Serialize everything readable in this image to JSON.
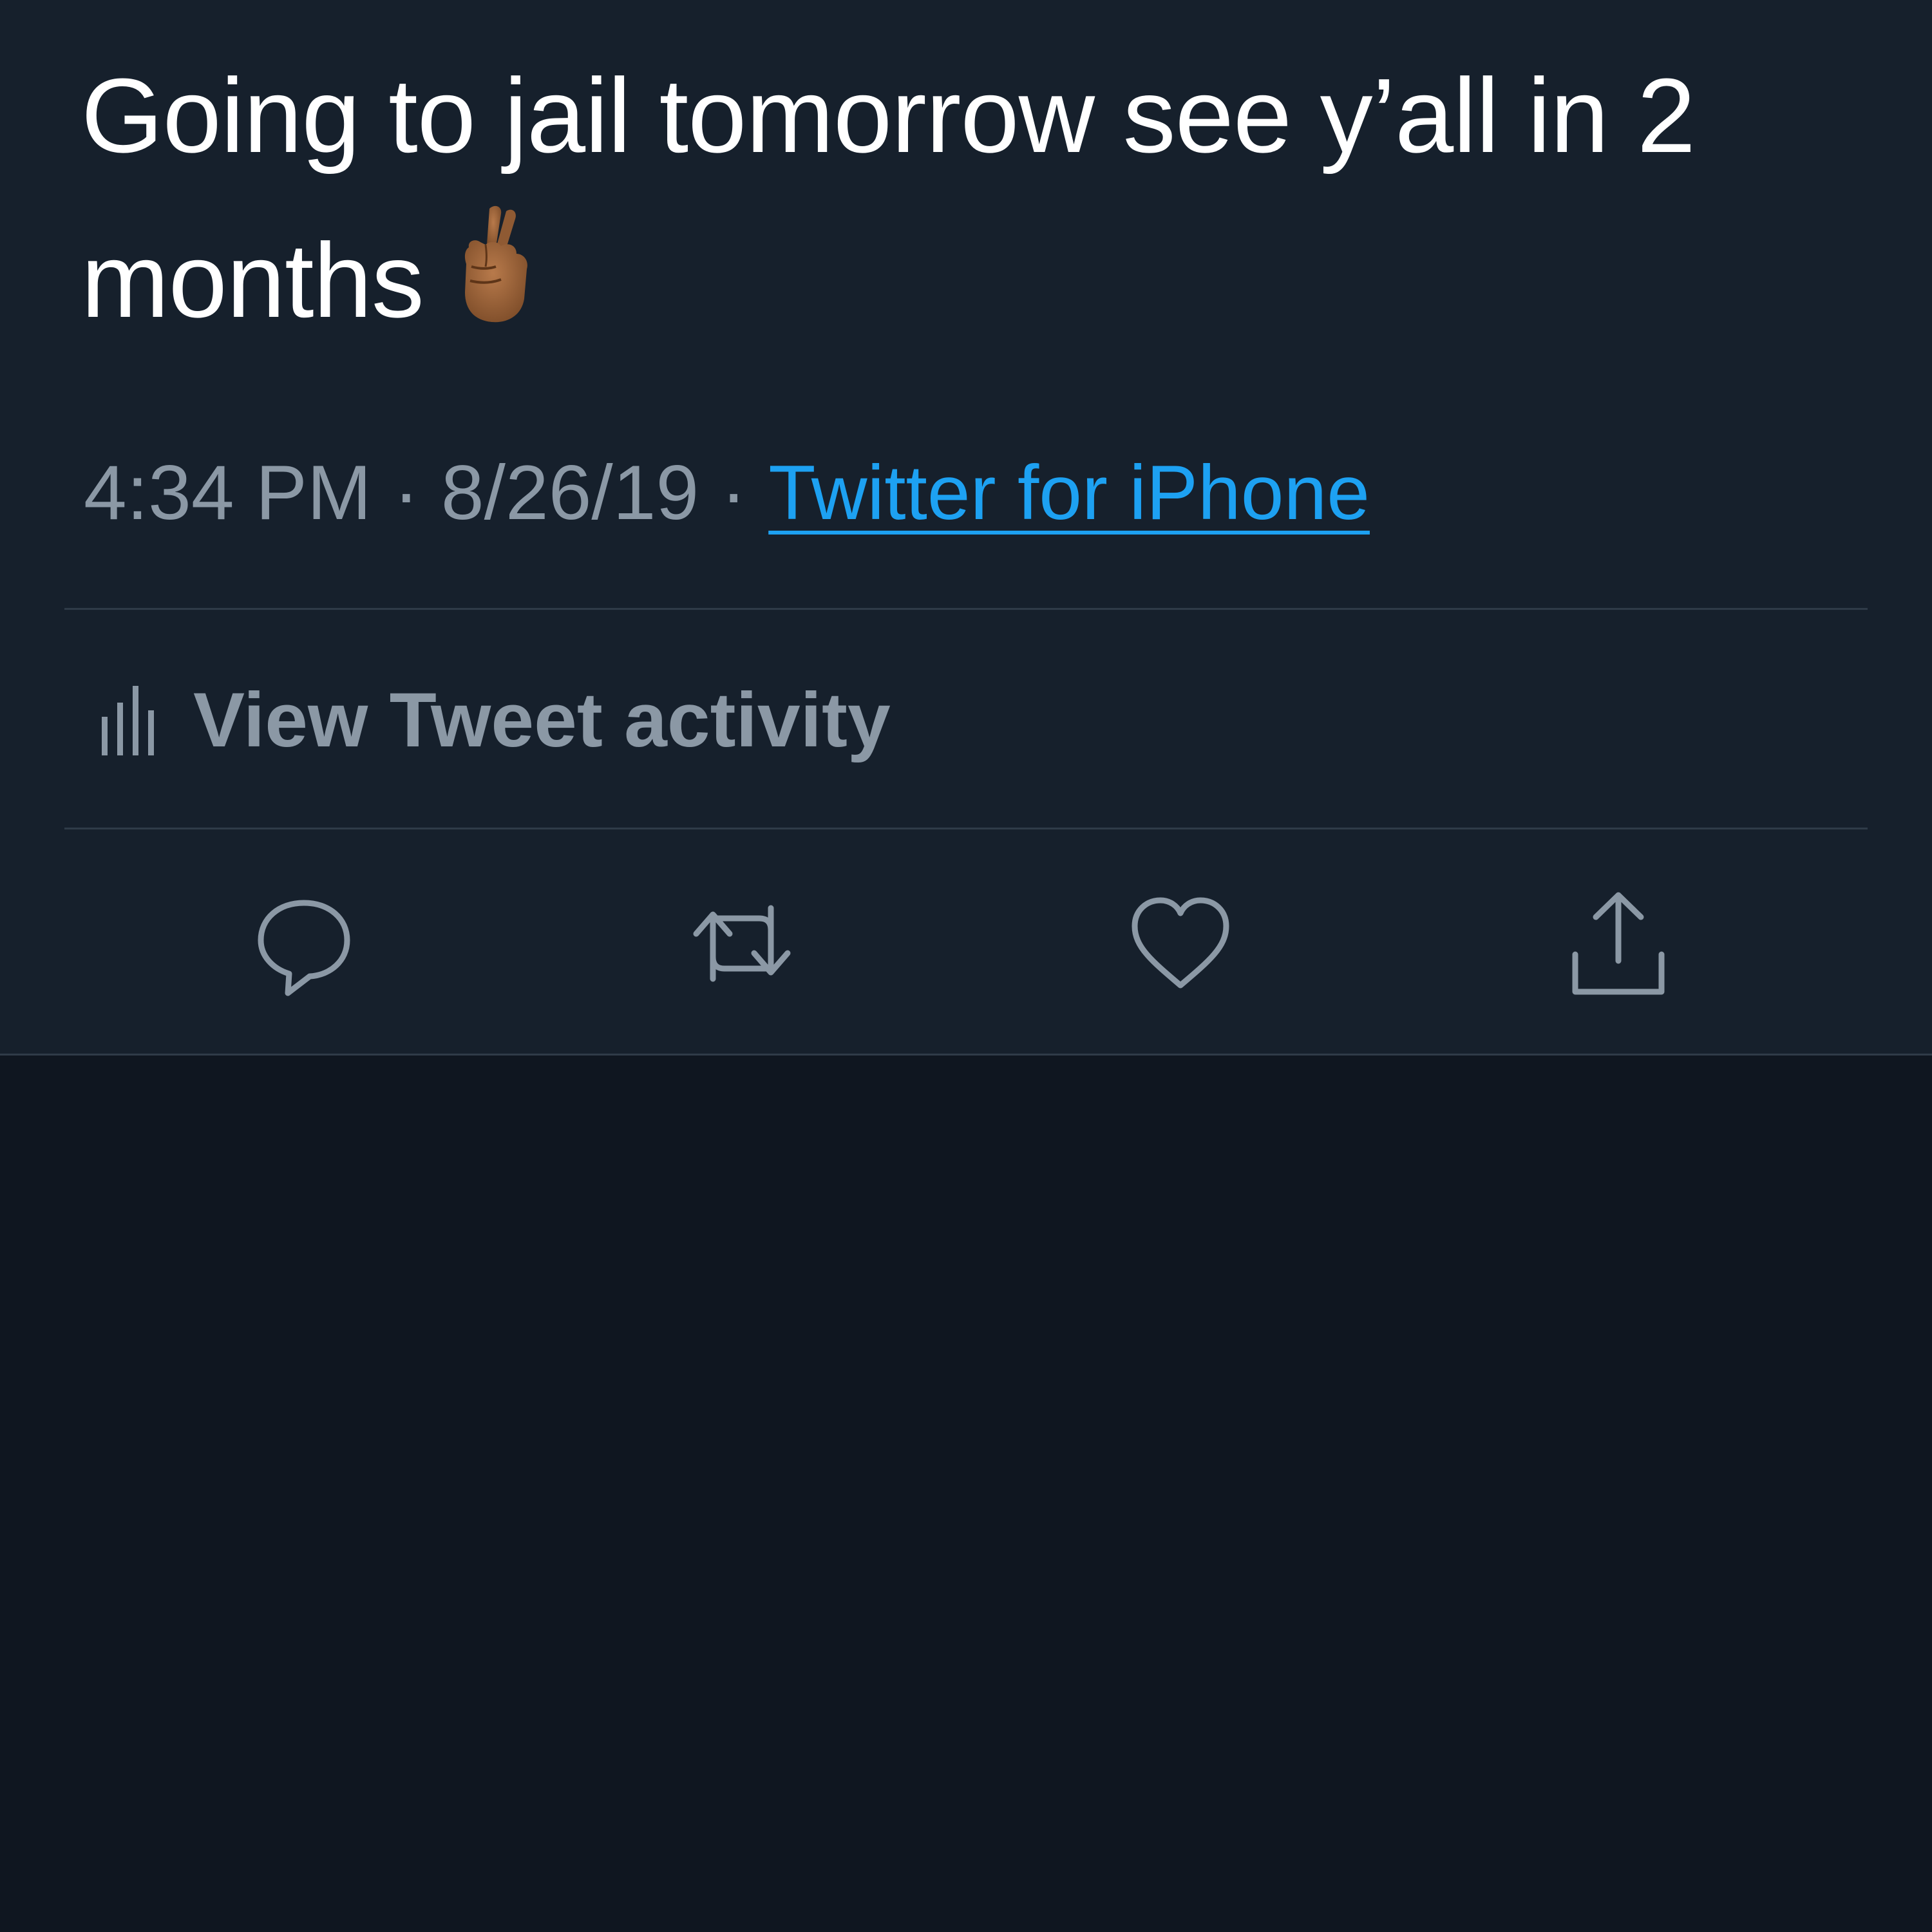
{
  "tweet": {
    "text": "Going to jail tomorrow see y’all in 2 months",
    "emoji": "crossed-fingers",
    "time": "4:34 PM",
    "separator": "·",
    "date": "8/26/19",
    "source": "Twitter for iPhone"
  },
  "activity": {
    "icon": "bar-chart-icon",
    "label": "View Tweet activity"
  },
  "actions": [
    {
      "name": "reply",
      "icon": "speech-bubble-icon"
    },
    {
      "name": "retweet",
      "icon": "retweet-arrows-icon"
    },
    {
      "name": "like",
      "icon": "heart-icon"
    },
    {
      "name": "share",
      "icon": "share-upload-icon"
    }
  ],
  "colors": {
    "background": "#0f1620",
    "card": "#16202c",
    "text": "#ffffff",
    "secondary_text": "#8b98a5",
    "link": "#1da1f2",
    "divider": "#2f3b48"
  }
}
